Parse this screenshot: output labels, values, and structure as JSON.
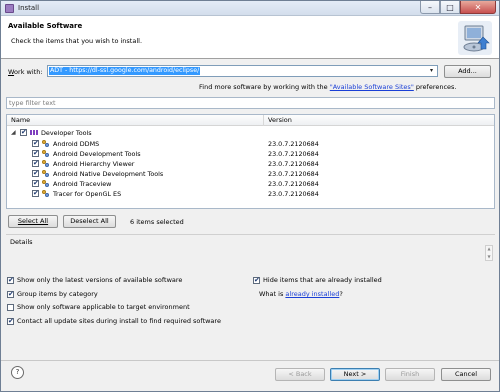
{
  "window": {
    "title": "Install",
    "controls": {
      "minimize": "–",
      "maximize": "□",
      "close": "✕"
    }
  },
  "banner": {
    "title": "Available Software",
    "description": "Check the items that you wish to install."
  },
  "work_with": {
    "label_mnemonic": "W",
    "label_rest": "ork with:",
    "value": "ADT - https://dl-ssl.google.com/android/eclipse/",
    "add_button": "Add...",
    "find_more_prefix": "Find more software by working with the ",
    "find_more_link": "\"Available Software Sites\"",
    "find_more_suffix": " preferences."
  },
  "filter": {
    "placeholder": "type filter text"
  },
  "table": {
    "columns": [
      "Name",
      "Version"
    ],
    "group": {
      "name": "Developer Tools",
      "checked": true,
      "expanded": true
    },
    "items": [
      {
        "name": "Android DDMS",
        "version": "23.0.7.2120684",
        "checked": true
      },
      {
        "name": "Android Development Tools",
        "version": "23.0.7.2120684",
        "checked": true
      },
      {
        "name": "Android Hierarchy Viewer",
        "version": "23.0.7.2120684",
        "checked": true
      },
      {
        "name": "Android Native Development Tools",
        "version": "23.0.7.2120684",
        "checked": true
      },
      {
        "name": "Android Traceview",
        "version": "23.0.7.2120684",
        "checked": true
      },
      {
        "name": "Tracer for OpenGL ES",
        "version": "23.0.7.2120684",
        "checked": true
      }
    ]
  },
  "selection": {
    "select_all": "Select All",
    "deselect_all": "Deselect All",
    "count_text": "6 items selected"
  },
  "details": {
    "label": "Details"
  },
  "options": [
    {
      "key": "latest",
      "label": "Show only the latest versions of available software",
      "checked": true
    },
    {
      "key": "group",
      "label": "Group items by category",
      "checked": true
    },
    {
      "key": "target",
      "label": "Show only software applicable to target environment",
      "checked": false
    },
    {
      "key": "contact",
      "label": "Contact all update sites during install to find required software",
      "checked": true
    },
    {
      "key": "hide",
      "label": "Hide items that are already installed",
      "checked": true
    }
  ],
  "what_is": {
    "prefix": "What is ",
    "link": "already installed",
    "suffix": "?"
  },
  "footer": {
    "help": "?",
    "back": "< Back",
    "next": "Next >",
    "finish": "Finish",
    "cancel": "Cancel"
  },
  "icons": {
    "window": "install-app-icon",
    "banner": "install-software-wizard-icon",
    "group": "category-folder-icon",
    "item": "feature-plugin-icon"
  }
}
